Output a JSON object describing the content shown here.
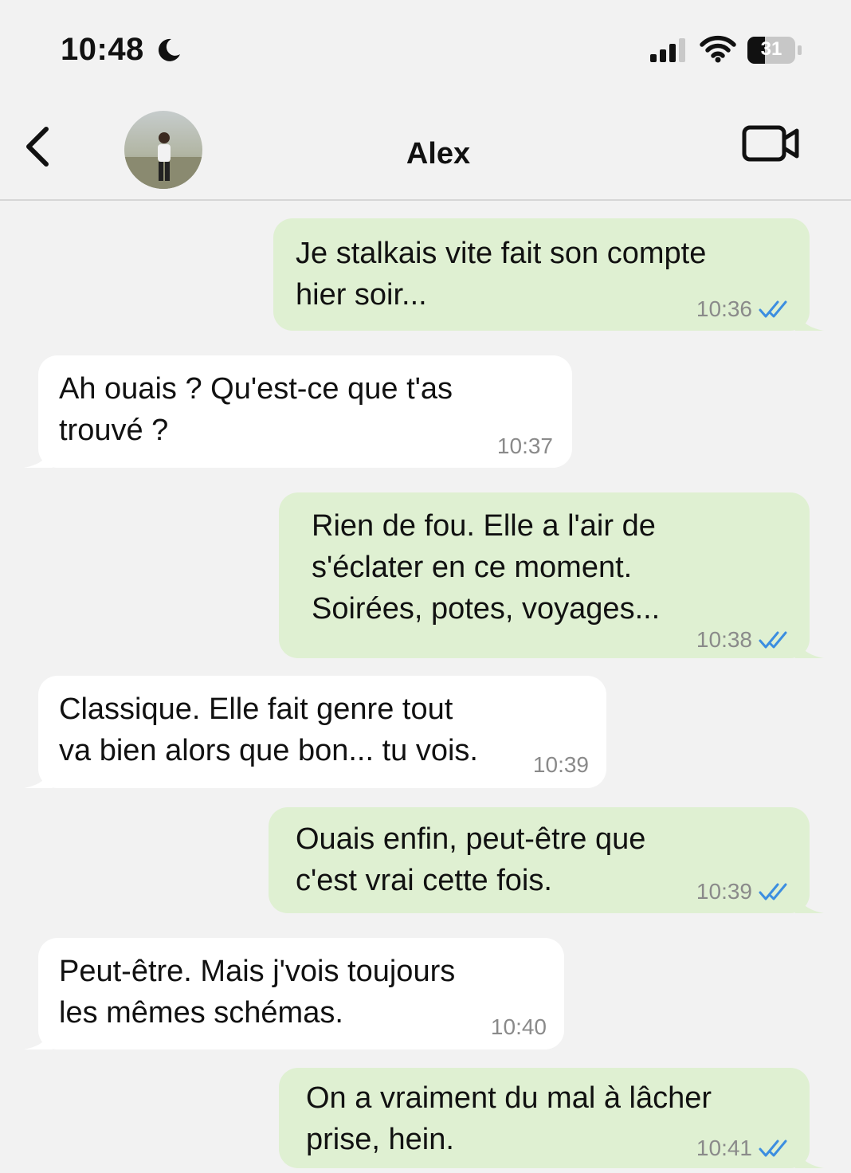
{
  "status_bar": {
    "time": "10:48",
    "battery_level": "31"
  },
  "header": {
    "contact_name": "Alex"
  },
  "colors": {
    "outgoing_bubble": "#dff0d2",
    "incoming_bubble": "#ffffff",
    "read_receipt": "#3c8ee0",
    "background": "#f2f2f2"
  },
  "messages": [
    {
      "direction": "outgoing",
      "text": "Je stalkais vite fait son compte\nhier soir...",
      "time": "10:36",
      "read": true
    },
    {
      "direction": "incoming",
      "text": "Ah ouais ? Qu'est-ce que t'as\ntrouvé ?",
      "time": "10:37"
    },
    {
      "direction": "outgoing",
      "text": "Rien de fou. Elle a l'air de\ns'éclater en ce moment.\nSoirées, potes, voyages...",
      "time": "10:38",
      "read": true
    },
    {
      "direction": "incoming",
      "text": "Classique. Elle fait genre tout\nva bien alors que bon... tu vois.",
      "time": "10:39"
    },
    {
      "direction": "outgoing",
      "text": "Ouais enfin, peut-être que\nc'est vrai cette fois.",
      "time": "10:39",
      "read": true
    },
    {
      "direction": "incoming",
      "text": "Peut-être. Mais j'vois toujours\nles mêmes schémas.",
      "time": "10:40"
    },
    {
      "direction": "outgoing",
      "text": "On a vraiment du mal à lâcher\nprise, hein.",
      "time": "10:41",
      "read": true
    }
  ]
}
